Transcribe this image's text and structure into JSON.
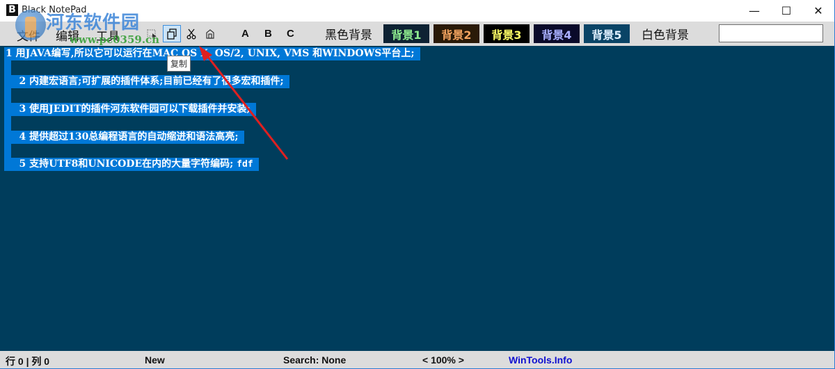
{
  "window": {
    "title": "Black NotePad",
    "app_icon": "B",
    "controls": {
      "minimize": "—",
      "maximize": "☐",
      "close": "✕"
    }
  },
  "watermark": {
    "cn": "河东软件园",
    "url": "www.pc0359.cn"
  },
  "menu": {
    "items": [
      "文件",
      "编辑",
      "工具"
    ]
  },
  "toolbar": {
    "icons": [
      {
        "name": "select-all-icon",
        "glyph": "⬚",
        "active": false
      },
      {
        "name": "copy-icon",
        "glyph": "⧉",
        "active": true
      },
      {
        "name": "cut-icon",
        "glyph": "✂",
        "active": false
      },
      {
        "name": "paste-icon",
        "glyph": "⌂",
        "active": false
      }
    ],
    "letters": [
      "A",
      "B",
      "C"
    ],
    "backgrounds": [
      {
        "label": "黑色背景",
        "bg": "transparent",
        "fg": "#111111"
      },
      {
        "label": "背景1",
        "bg": "#0e2233",
        "fg": "#90ee90"
      },
      {
        "label": "背景2",
        "bg": "#2a1a08",
        "fg": "#f4a460"
      },
      {
        "label": "背景3",
        "bg": "#000000",
        "fg": "#ffff66"
      },
      {
        "label": "背景4",
        "bg": "#0a0a2a",
        "fg": "#aab0ff"
      },
      {
        "label": "背景5",
        "bg": "#0a4466",
        "fg": "#e0f0ff"
      },
      {
        "label": "白色背景",
        "bg": "transparent",
        "fg": "#111111"
      }
    ],
    "search_value": ""
  },
  "tooltip": "复制",
  "editor": {
    "bg_color": "#003d5c",
    "selection_color": "#0078d7",
    "lines": [
      {
        "text": "1 用JAVA编写,所以它可以运行在MAC OS X, OS/2, UNIX, VMS 和WINDOWS平台上;",
        "extra": ""
      },
      {
        "text": "    2 内建宏语言;可扩展的插件体系;目前已经有了很多宏和插件;",
        "extra": ""
      },
      {
        "text": "    3 使用JEDIT的插件河东软件园可以下载插件并安装;",
        "extra": ""
      },
      {
        "text": "    4 提供超过130总编程语言的自动缩进和语法高亮;",
        "extra": ""
      },
      {
        "text": "    5 支持UTF8和UNICODE在内的大量字符编码; ",
        "extra": "fdf"
      }
    ]
  },
  "status": {
    "position": "行 0 | 列 0",
    "file_state": "New",
    "search": "Search: None",
    "zoom": "< 100% >",
    "link": "WinTools.Info"
  },
  "annotation": {
    "color": "#e02020"
  }
}
